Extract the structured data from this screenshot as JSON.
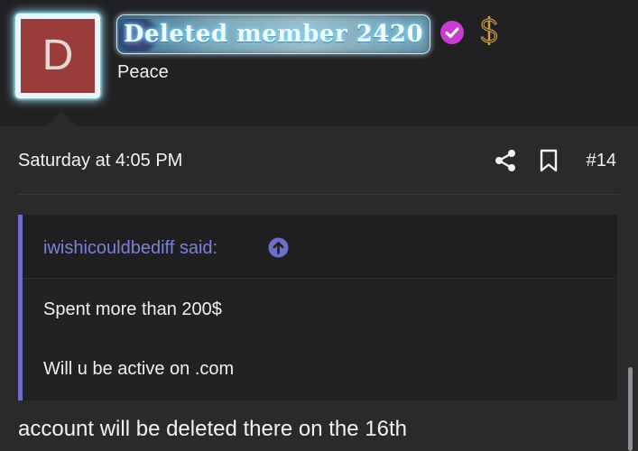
{
  "user": {
    "avatar_letter": "D",
    "avatar_color": "#9a3d3a",
    "username": "Deleted member 2420",
    "user_title": "Peace",
    "badges": [
      "verified-check-icon",
      "dollar-sign-icon"
    ],
    "verified_color": "#c93bd1",
    "dollar_color": "#c9a24a"
  },
  "post": {
    "date": "Saturday at 4:05 PM",
    "actions": [
      "share-icon",
      "bookmark-icon"
    ],
    "post_number": "#14"
  },
  "quote": {
    "author": "iwishicouldbediff said:",
    "accent_color": "#6a6fc7",
    "lines": [
      "Spent more than 200$",
      "Will u be active on .com"
    ]
  },
  "reply": {
    "text": "account will be deleted there on the 16th"
  }
}
